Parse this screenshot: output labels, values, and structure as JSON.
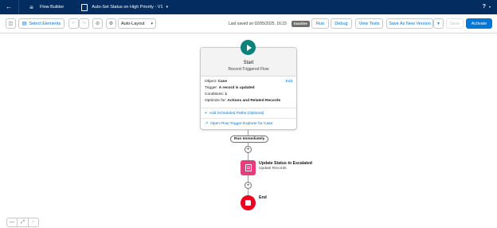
{
  "header": {
    "back_icon": "arrow-left-icon",
    "app_name": "Flow Builder",
    "flow_title": "Auto-Set Status on High Priority - V1",
    "help_label": "?"
  },
  "toolbar": {
    "select_elements": "Select Elements",
    "layout_value": "Auto-Layout",
    "last_saved": "Last saved on 02/05/2025, 16:23",
    "status_badge": "Inactive",
    "run": "Run",
    "debug": "Debug",
    "view_tests": "View Tests",
    "save_as_new": "Save As New Version",
    "save": "Save",
    "activate": "Activate"
  },
  "start": {
    "title": "Start",
    "subtitle": "Record-Triggered Flow",
    "edit": "Edit",
    "object_label": "Object:",
    "object_value": "Case",
    "trigger_label": "Trigger:",
    "trigger_value": "A record is updated",
    "conditions_label": "Conditions:",
    "conditions_value": "1",
    "optimize_label": "Optimize for:",
    "optimize_value": "Actions and Related Records",
    "add_paths": "Add Scheduled Paths (Optional)",
    "open_explorer": "Open Flow Trigger Explorer for Case"
  },
  "path": {
    "label": "Run Immediately"
  },
  "action": {
    "title": "Update Status to Escalated",
    "subtitle": "Update Records"
  },
  "end": {
    "label": "End"
  },
  "colors": {
    "nav": "#032d60",
    "brand": "#0176d3",
    "start": "#0b827c",
    "action": "#e33f7e",
    "end": "#ea001e"
  }
}
